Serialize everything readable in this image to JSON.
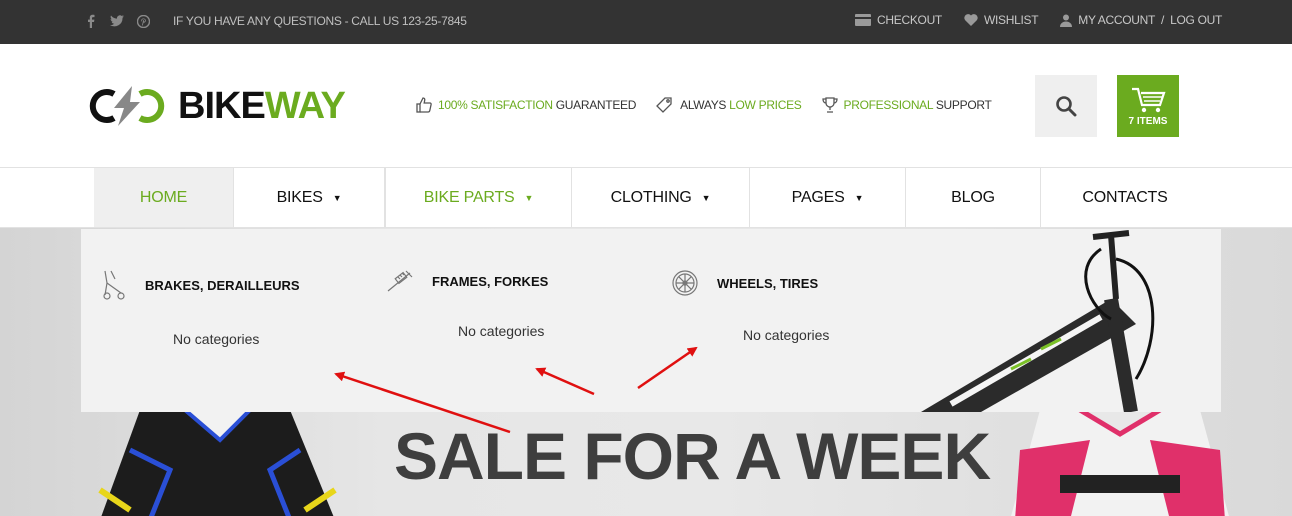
{
  "topbar": {
    "social": [
      "facebook-icon",
      "twitter-icon",
      "pinterest-icon"
    ],
    "message": "IF YOU HAVE ANY QUESTIONS - CALL US 123-25-7845",
    "links": {
      "checkout": "CHECKOUT",
      "wishlist": "WISHLIST",
      "account": "MY ACCOUNT",
      "sep": "/",
      "logout": "LOG OUT"
    }
  },
  "logo": {
    "part1": "BIKE",
    "part2": "WAY"
  },
  "features": [
    {
      "icon": "thumbs-up-icon",
      "green": "100% SATISFACTION",
      "plain": " GUARANTEED"
    },
    {
      "icon": "price-tag-icon",
      "plain": "ALWAYS ",
      "green": "LOW PRICES"
    },
    {
      "icon": "trophy-icon",
      "green": "PROFESSIONAL",
      "plain": " SUPPORT"
    }
  ],
  "cart": {
    "count_label": "7 ITEMS"
  },
  "nav": {
    "home": "HOME",
    "bikes": "BIKES",
    "bike_parts": "BIKE PARTS",
    "clothing": "CLOTHING",
    "pages": "PAGES",
    "blog": "BLOG",
    "contacts": "CONTACTS"
  },
  "dropdown": {
    "columns": [
      {
        "icon": "brake-icon",
        "title": "BRAKES, DERAILLEURS",
        "sub": "No categories"
      },
      {
        "icon": "fork-icon",
        "title": "FRAMES, FORKES",
        "sub": "No categories"
      },
      {
        "icon": "wheel-icon",
        "title": "WHEELS, TIRES",
        "sub": "No categories"
      }
    ]
  },
  "hero": {
    "title": "SALE FOR A WEEK"
  },
  "colors": {
    "accent": "#6bab1f",
    "topbar": "#333333",
    "annotation": "#e01010"
  }
}
